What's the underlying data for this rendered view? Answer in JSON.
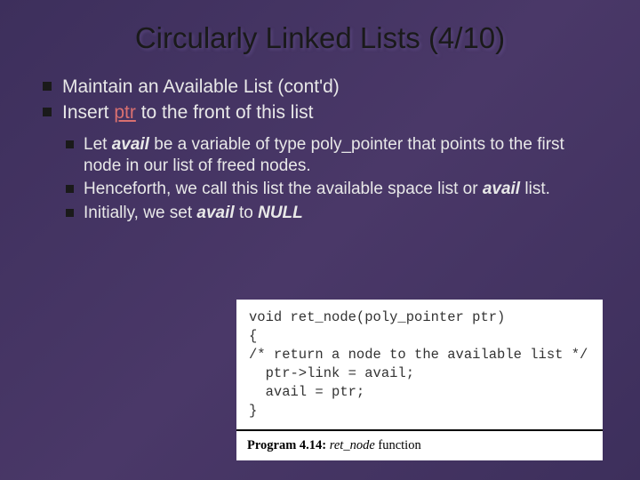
{
  "title": "Circularly Linked Lists (4/10)",
  "bullets": {
    "b1": "Maintain an Available List (cont'd)",
    "b2_pre": "Insert ",
    "b2_ptr": "ptr",
    "b2_post": " to the front of this list"
  },
  "sub": {
    "s1_pre": "Let ",
    "s1_avail": "avail",
    "s1_post": " be a variable of type poly_pointer that points to the first node in our list of freed nodes.",
    "s2_pre": "Henceforth, we call this list the available space list or ",
    "s2_avail": "avail",
    "s2_post": " list.",
    "s3_pre": "Initially, we set ",
    "s3_avail": "avail",
    "s3_mid": " to ",
    "s3_null": "NULL"
  },
  "code": {
    "line1": "void ret_node(poly_pointer ptr)",
    "line2": "{",
    "line3": "/* return a node to the available list */",
    "line4": "  ptr->link = avail;",
    "line5": "  avail = ptr;",
    "line6": "}"
  },
  "caption": {
    "prog": "Program 4.14:",
    "fn": "ret_node",
    "rest": " function"
  }
}
